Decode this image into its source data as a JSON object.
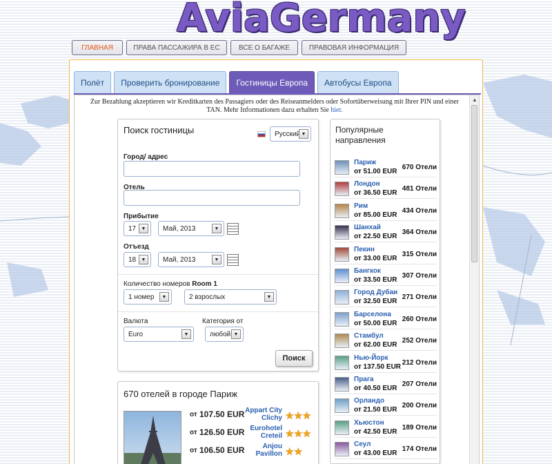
{
  "logo": "AviaGermany",
  "topnav": [
    {
      "label": "ГЛАВНАЯ",
      "active": true
    },
    {
      "label": "ПРАВА ПАССАЖИРА В ЕС",
      "active": false
    },
    {
      "label": "ВСЕ О БАГАЖЕ",
      "active": false
    },
    {
      "label": "ПРАВОВАЯ ИНФОРМАЦИЯ",
      "active": false
    }
  ],
  "tabs": [
    {
      "label": "Полёт",
      "active": false
    },
    {
      "label": "Проверить бронирование",
      "active": false
    },
    {
      "label": "Гостиницы Европа",
      "active": true
    },
    {
      "label": "Автобусы Европа",
      "active": false
    }
  ],
  "notice": {
    "text": "Zur Bezahlung akzeptieren wir Kreditkarten des Passagiers oder des Reiseanmelders oder Sofortüberweisung mit Ihrer PIN und einer TAN. Mehr Informationen dazu erhalten Sie",
    "link": "hier."
  },
  "search": {
    "title": "Поиск гостиницы",
    "language": "Русский",
    "city_label": "Город/ адрес",
    "city_value": "",
    "hotel_label": "Отель",
    "hotel_value": "",
    "arrival_label": "Прибытие",
    "arrival_day": "17",
    "arrival_month": "Май, 2013",
    "departure_label": "Отъезд",
    "departure_day": "18",
    "departure_month": "Май, 2013",
    "rooms_label": "Количество номеров",
    "rooms_room": "Room 1",
    "rooms_value": "1 номер",
    "guests_value": "2 взрослых",
    "currency_label": "Валюта",
    "currency_value": "Euro",
    "category_label": "Категория от",
    "category_value": "любой",
    "search_button": "Поиск"
  },
  "popular": {
    "title": "Популярные направления",
    "items": [
      {
        "name": "Париж",
        "price": "от 51.00 EUR",
        "count": "670 Отели",
        "color": "#6f8fb8"
      },
      {
        "name": "Лондон",
        "price": "от 36.50 EUR",
        "count": "481 Отели",
        "color": "#b04040"
      },
      {
        "name": "Рим",
        "price": "от 85.00 EUR",
        "count": "434 Отели",
        "color": "#b7864a"
      },
      {
        "name": "Шанхай",
        "price": "от 22.50 EUR",
        "count": "364 Отели",
        "color": "#3a3050"
      },
      {
        "name": "Пекин",
        "price": "от 33.00 EUR",
        "count": "315 Отели",
        "color": "#a04a3a"
      },
      {
        "name": "Бангкок",
        "price": "от 33.50 EUR",
        "count": "307 Отели",
        "color": "#5f8fd0"
      },
      {
        "name": "Город Дубаи",
        "price": "от 32.50 EUR",
        "count": "271 Отели",
        "color": "#8fb0d8"
      },
      {
        "name": "Барселона",
        "price": "от 50.00 EUR",
        "count": "260 Отели",
        "color": "#7ca0cc"
      },
      {
        "name": "Стамбул",
        "price": "от 62.00 EUR",
        "count": "252 Отели",
        "color": "#b08a50"
      },
      {
        "name": "Нью-Йорк",
        "price": "от 137.50 EUR",
        "count": "212 Отели",
        "color": "#5aa085"
      },
      {
        "name": "Прага",
        "price": "от 40.50 EUR",
        "count": "207 Отели",
        "color": "#4a5f88"
      },
      {
        "name": "Орландо",
        "price": "от 21.50 EUR",
        "count": "200 Отели",
        "color": "#6f9fc8"
      },
      {
        "name": "Хьюстон",
        "price": "от 42.50 EUR",
        "count": "189 Отели",
        "color": "#5aa085"
      },
      {
        "name": "Сеул",
        "price": "от 43.00 EUR",
        "count": "174 Отели",
        "color": "#8a5aa0"
      }
    ]
  },
  "results": {
    "title": "670 отелей в городе Париж",
    "from": "от",
    "hotels": [
      {
        "price": "107.50 EUR",
        "name": "Appart City Clichy",
        "stars": "★★★"
      },
      {
        "price": "126.50 EUR",
        "name": "Eurohotel Creteil",
        "stars": "★★★"
      },
      {
        "price": "106.50 EUR",
        "name": "Anjou Pavillon",
        "stars": "★★"
      }
    ]
  }
}
